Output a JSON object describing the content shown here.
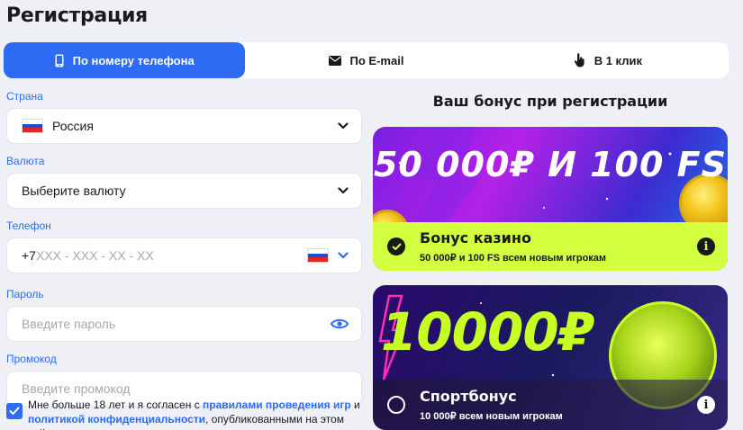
{
  "page": {
    "title": "Регистрация"
  },
  "tabs": [
    {
      "label": "По номеру телефона",
      "icon": "phone-icon",
      "active": true
    },
    {
      "label": "По E-mail",
      "icon": "envelope-icon",
      "active": false
    },
    {
      "label": "В 1 клик",
      "icon": "hand-pointer-icon",
      "active": false
    }
  ],
  "form": {
    "country": {
      "label": "Страна",
      "value": "Россия"
    },
    "currency": {
      "label": "Валюта",
      "value": "Выберите валюту"
    },
    "phone": {
      "label": "Телефон",
      "prefix": "+7",
      "placeholder": "XXX - XXX - XX - XX"
    },
    "password": {
      "label": "Пароль",
      "placeholder": "Введите пароль"
    },
    "promo": {
      "label": "Промокод",
      "placeholder": "Введите промокод"
    }
  },
  "agreement": {
    "checked": true,
    "text_before": "Мне больше 18 лет и я согласен с ",
    "link_rules": "правилами проведения игр",
    "text_and": " и ",
    "link_privacy": "политикой конфиденциальности",
    "text_after": ", опубликованными на этом сайте"
  },
  "bonus": {
    "section_title": "Ваш бонус при регистрации",
    "cards": [
      {
        "headline": "50 000₽ И 100 FS",
        "name": "Бонус казино",
        "desc": "50 000₽ и 100 FS всем новым игрокам",
        "selected": true
      },
      {
        "headline": "10000₽",
        "name": "Спортбонус",
        "desc": "10 000₽ всем новым игрокам",
        "selected": false
      }
    ]
  },
  "colors": {
    "accent": "#2d6bf2",
    "lime": "#d2ff3e",
    "text": "#1a1a1a"
  }
}
